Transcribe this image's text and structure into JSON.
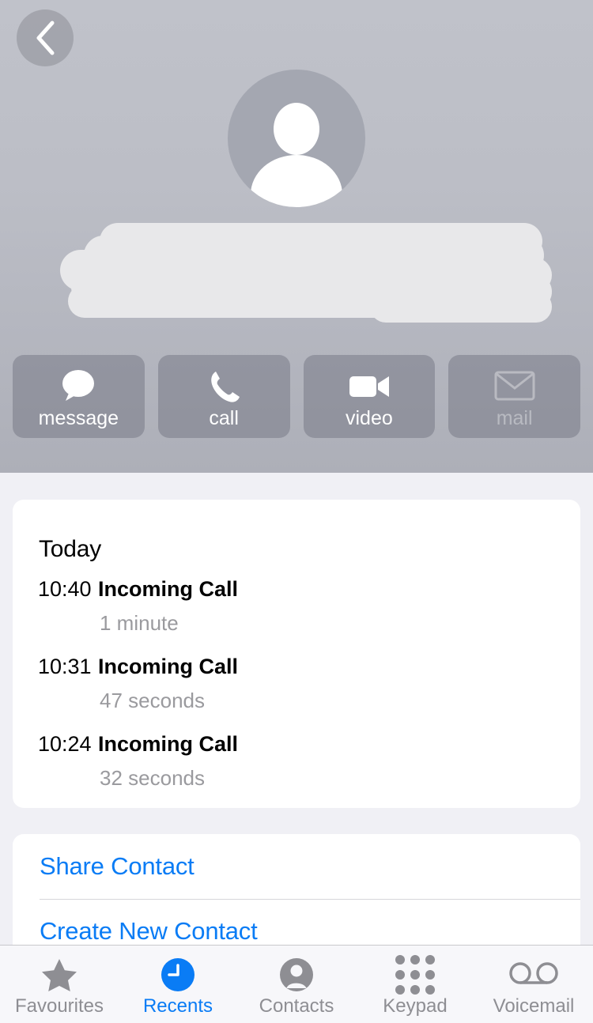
{
  "header": {
    "back_button": "back-chevron",
    "avatar_icon": "person-placeholder-avatar",
    "contact_name_redacted": true,
    "actions": [
      {
        "label": "message",
        "icon": "message-bubble-icon",
        "disabled": false
      },
      {
        "label": "call",
        "icon": "phone-icon",
        "disabled": false
      },
      {
        "label": "video",
        "icon": "video-camera-icon",
        "disabled": false
      },
      {
        "label": "mail",
        "icon": "envelope-icon",
        "disabled": true
      }
    ]
  },
  "call_history": {
    "title": "Today",
    "entries": [
      {
        "time": "10:40",
        "type": "Incoming Call",
        "duration": "1 minute"
      },
      {
        "time": "10:31",
        "type": "Incoming Call",
        "duration": "47 seconds"
      },
      {
        "time": "10:24",
        "type": "Incoming Call",
        "duration": "32 seconds"
      }
    ]
  },
  "contact_actions": [
    {
      "label": "Share Contact"
    },
    {
      "label": "Create New Contact"
    }
  ],
  "tab_bar": {
    "active": "Recents",
    "items": [
      {
        "label": "Favourites",
        "icon": "star-icon",
        "active": false
      },
      {
        "label": "Recents",
        "icon": "clock-icon",
        "active": true
      },
      {
        "label": "Contacts",
        "icon": "person-icon",
        "active": false
      },
      {
        "label": "Keypad",
        "icon": "keypad-icon",
        "active": false
      },
      {
        "label": "Voicemail",
        "icon": "voicemail-icon",
        "active": false
      }
    ]
  },
  "colors": {
    "accent": "#0a7cf5",
    "page_background": "#f0f0f5",
    "card_background": "#ffffff",
    "muted_text": "#8e8e93",
    "redaction": "#e8e8ea"
  }
}
